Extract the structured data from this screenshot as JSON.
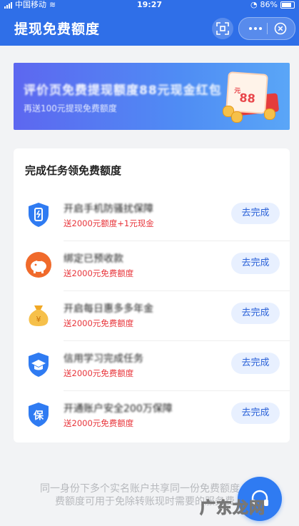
{
  "status_bar": {
    "carrier": "中国移动",
    "time": "19:27",
    "battery": "86%"
  },
  "header": {
    "title": "提现免费额度",
    "scan_icon": "scan-icon",
    "more_icon": "more-dots-icon",
    "close_icon": "close-circle-icon"
  },
  "banner": {
    "line1": "评价页免费提现额度88元现金红包",
    "line2": "再送100元提现免费额度",
    "amount": "88",
    "unit": "元"
  },
  "tasks_section": {
    "title": "完成任务领免费额度",
    "button_label": "去完成",
    "items": [
      {
        "icon": "shield-phone-icon",
        "name": "开启手机防骚扰保障",
        "reward": "送2000元额度+1元现金"
      },
      {
        "icon": "piggy-bank-icon",
        "name": "绑定已预收款",
        "reward": "送2000元免费额度"
      },
      {
        "icon": "money-bag-icon",
        "name": "开启每日惠多多年金",
        "reward": "送2000元免费额度"
      },
      {
        "icon": "graduation-shield-icon",
        "name": "信用学习完成任务",
        "reward": "送2000元免费额度"
      },
      {
        "icon": "protect-badge-icon",
        "name": "开通账户安全200万保障",
        "reward": "送2000元免费额度"
      }
    ]
  },
  "footer": {
    "note": "同一身份下多个实名账户共享同一份免费额度。免费额度可用于免除转账现时需要的服务费。",
    "service_icon": "headset-service-icon",
    "watermark": "广东龙网"
  },
  "colors": {
    "primary": "#2f6fe8",
    "reward_red": "#e8343a",
    "button_bg": "#e8f0ff"
  }
}
